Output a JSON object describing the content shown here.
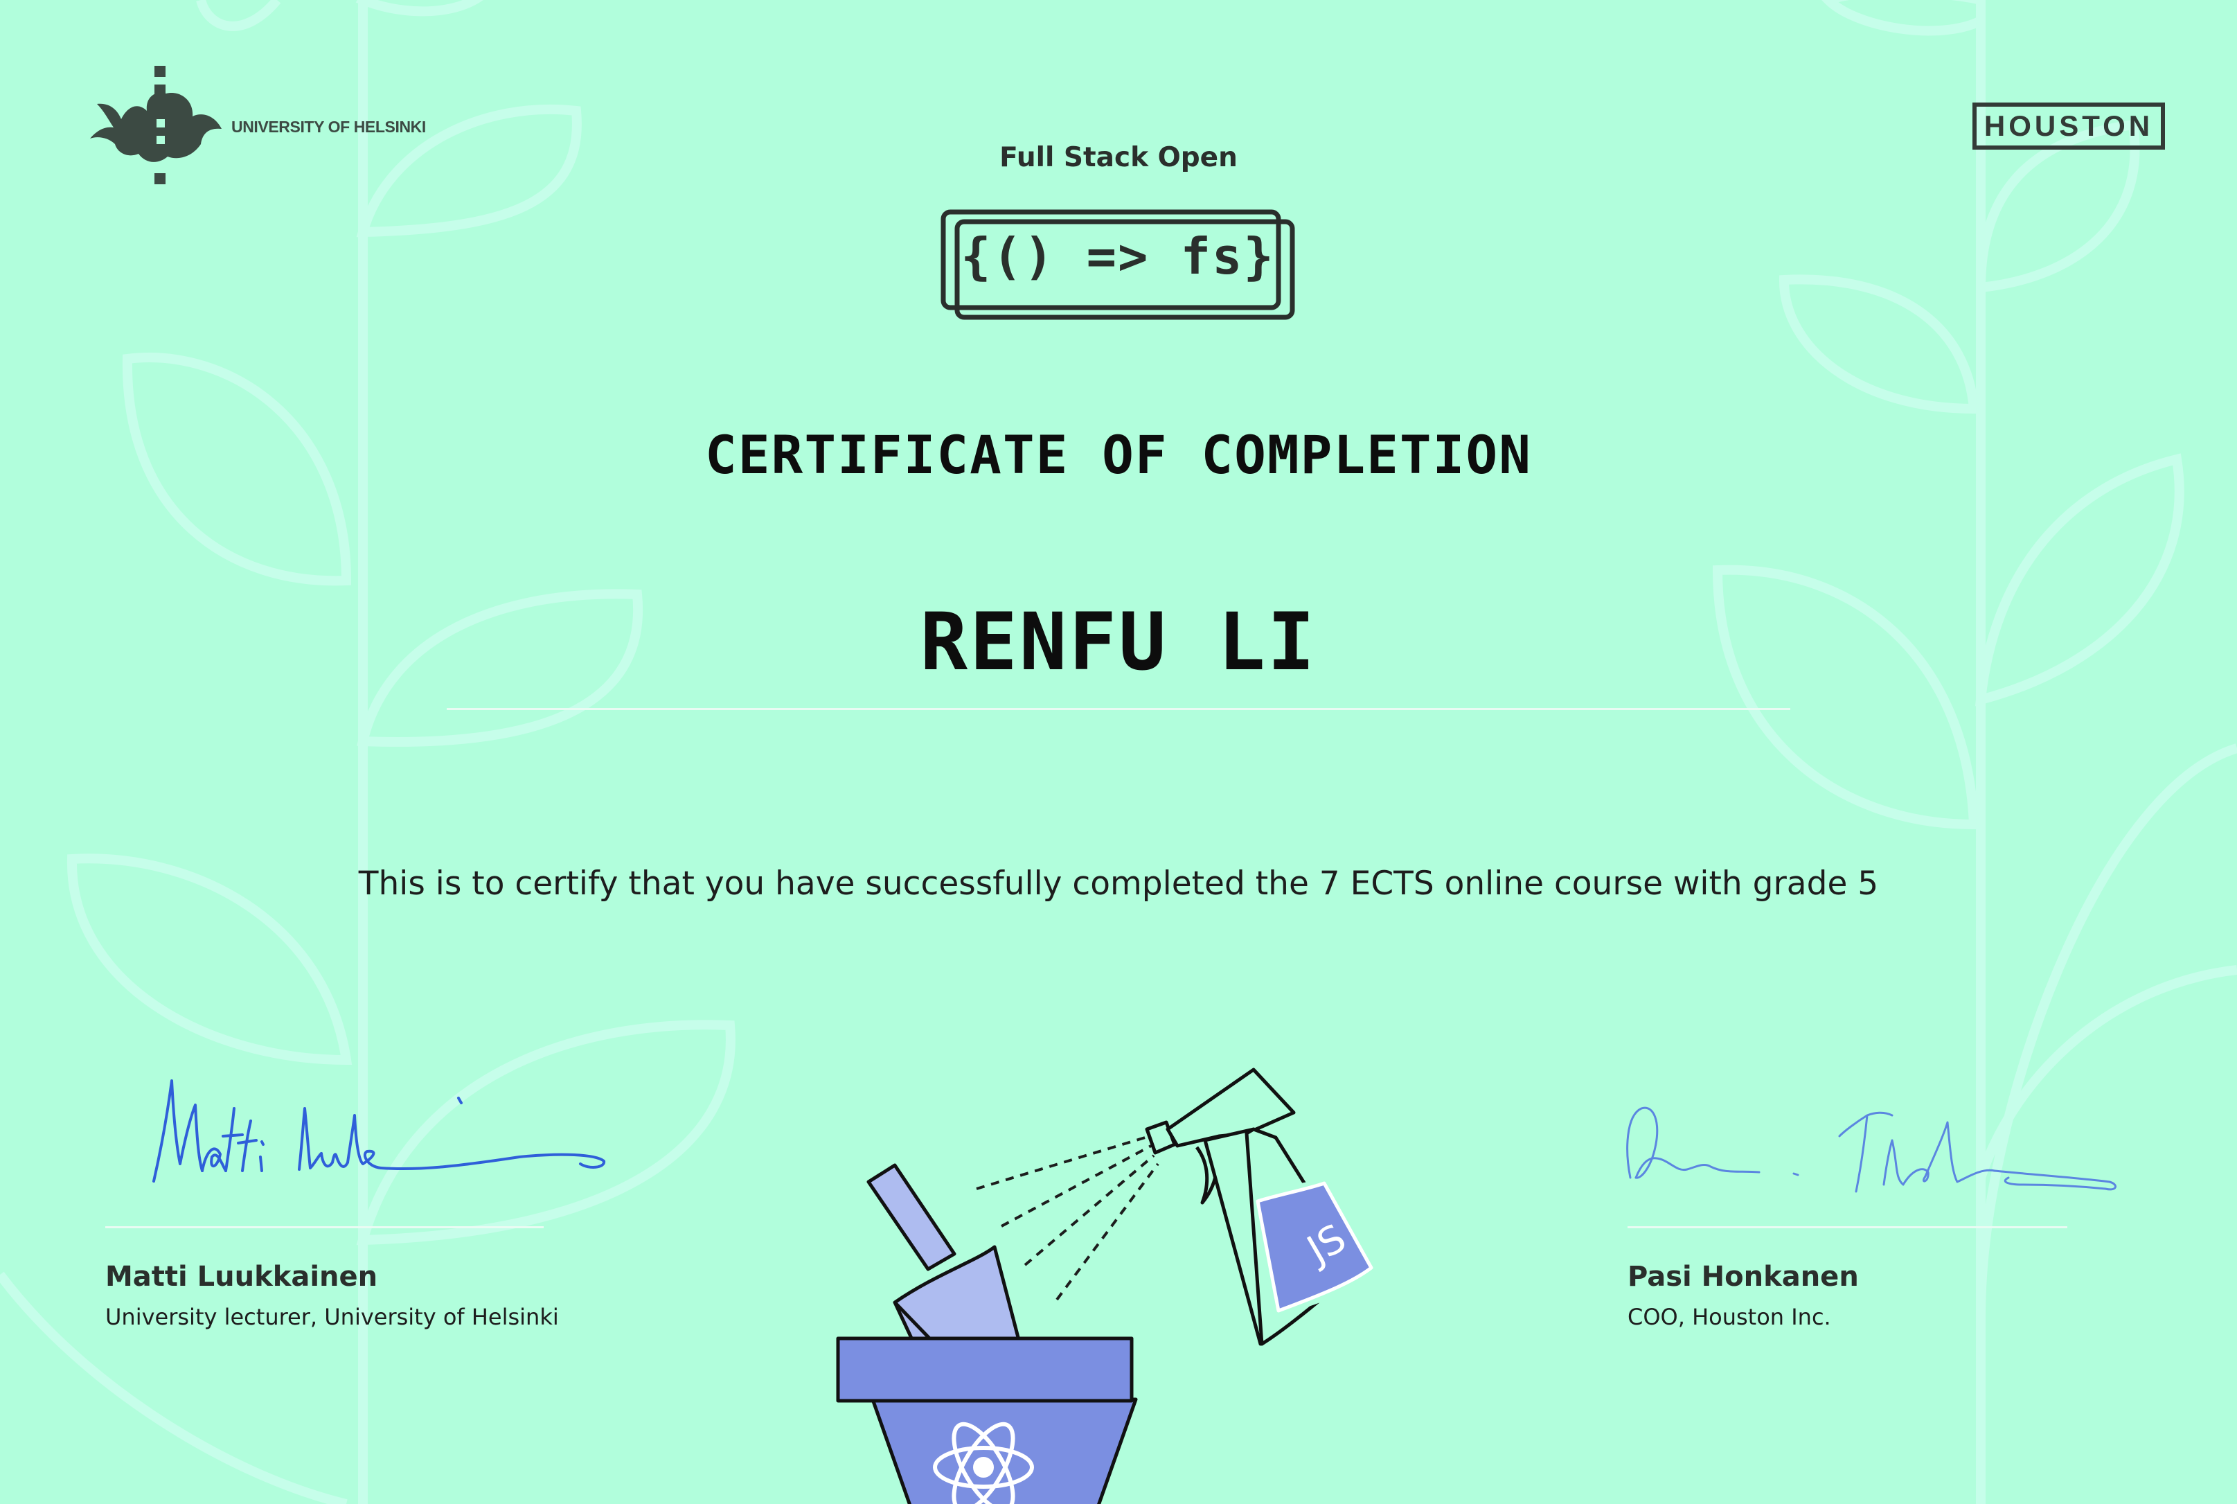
{
  "header": {
    "university_logo_text": "UNIVERSITY OF HELSINKI",
    "partner_logo_text": "HOUSTON",
    "course_name": "Full Stack Open",
    "course_logo_text": "{() => fs}"
  },
  "certificate": {
    "heading": "CERTIFICATE OF COMPLETION",
    "recipient_name": "RENFU LI",
    "statement": "This is to certify that you have successfully completed the 7 ECTS online course with grade 5"
  },
  "signatories": [
    {
      "name": "Matti Luukkainen",
      "title": "University lecturer, University of Helsinki"
    },
    {
      "name": "Pasi Honkanen",
      "title": "COO, Houston Inc."
    }
  ],
  "illustration": {
    "bottle_label": "JS",
    "pot_icon": "react-atom-icon"
  },
  "colors": {
    "background": "#b1fedc",
    "pattern": "#c6feea",
    "illustration_fill": "#7b8fe1",
    "illustration_light": "#aebcf0",
    "signature_blue": "#2f5fd9"
  }
}
